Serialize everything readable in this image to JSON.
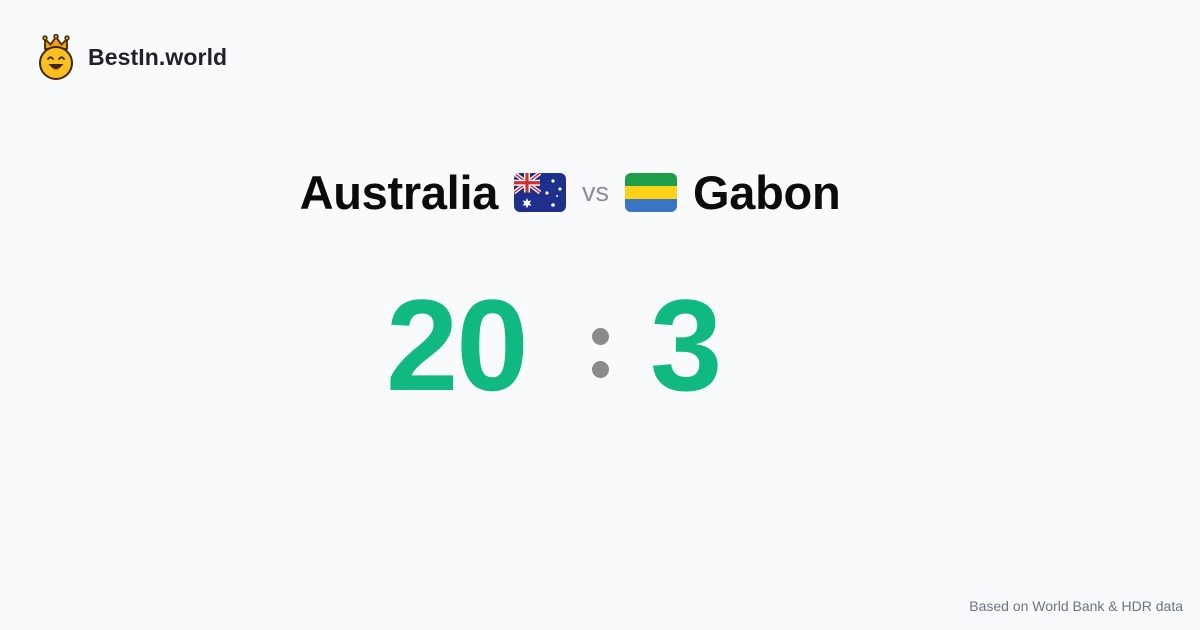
{
  "brand": {
    "name": "BestIn.world",
    "logo_icon": "crowned-smiley-icon"
  },
  "comparison": {
    "left_country": "Australia",
    "left_flag_icon": "australia-flag-icon",
    "vs_label": "vs",
    "right_country": "Gabon",
    "right_flag_icon": "gabon-flag-icon"
  },
  "score": {
    "left": "20",
    "right": "3"
  },
  "footer": {
    "note": "Based on World Bank & HDR data"
  },
  "colors": {
    "score_green": "#10b981",
    "background": "#f9fafb",
    "separator_gray": "#8b8b8b"
  }
}
